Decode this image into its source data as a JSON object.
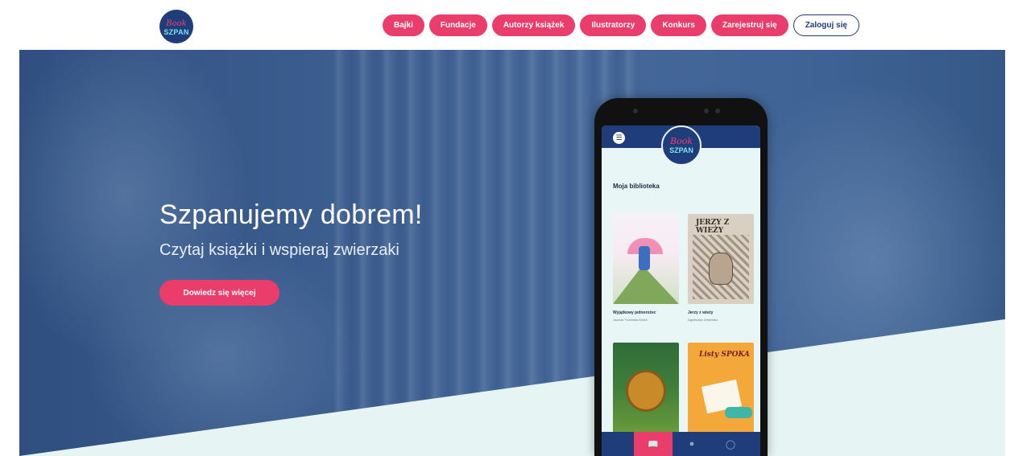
{
  "brand": {
    "logo_line1": "Book",
    "logo_line2": "SZPAN"
  },
  "nav": {
    "items": [
      "Bajki",
      "Fundacje",
      "Autorzy książek",
      "Ilustratorzy",
      "Konkurs",
      "Zarejestruj się"
    ],
    "login_label": "Zaloguj się"
  },
  "hero": {
    "title": "Szpanujemy dobrem!",
    "subtitle": "Czytaj książki i wspieraj zwierzaki",
    "cta_label": "Dowiedz się więcej"
  },
  "app": {
    "logo_line1": "Book",
    "logo_line2": "SZPAN",
    "section_title": "Moja biblioteka",
    "books": [
      {
        "title": "Wyjątkowy jednorożec",
        "author": "Joanna Trzcińska-Kotek",
        "cover_text": ""
      },
      {
        "title": "Jerzy z wieży",
        "author": "Agnieszka Urbańska",
        "cover_text": "JERZY Z WIEŻY"
      },
      {
        "title": "",
        "author": "",
        "cover_text": ""
      },
      {
        "title": "",
        "author": "",
        "cover_text": "Listy SPOKA"
      }
    ],
    "tabs": [
      "library-icon",
      "mask-icon",
      "user-icon"
    ]
  },
  "colors": {
    "accent": "#ea3d6c",
    "brand_blue": "#1f3d7a",
    "hero_bg": "#3d5f8f",
    "mint": "#e6f4f3"
  }
}
